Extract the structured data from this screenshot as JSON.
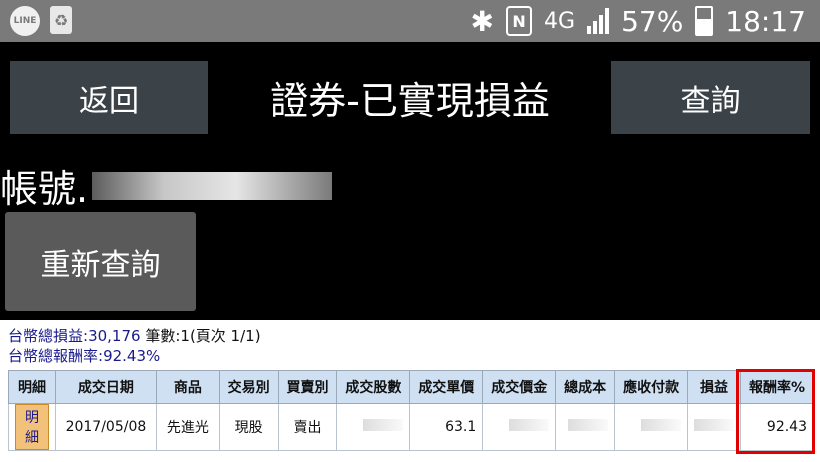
{
  "status_bar": {
    "line_label": "LINE",
    "network": "4G",
    "battery": "57%",
    "time": "18:17"
  },
  "header": {
    "back_label": "返回",
    "title": "證券-已實現損益",
    "query_label": "查詢"
  },
  "account": {
    "label": "帳號."
  },
  "requery_label": "重新查詢",
  "summary": {
    "total_pnl_label": "台幣總損益:",
    "total_pnl": "30,176",
    "count_text": "筆數:1(頁次 1/1)",
    "total_return_label": "台幣總報酬率:",
    "total_return": "92.43%"
  },
  "table": {
    "headers": [
      "明細",
      "成交日期",
      "商品",
      "交易別",
      "買賣別",
      "成交股數",
      "成交單價",
      "成交價金",
      "總成本",
      "應收付款",
      "損益",
      "報酬率%"
    ],
    "rows": [
      {
        "detail": "明細",
        "date": "2017/05/08",
        "product": "先進光",
        "trade_type": "現股",
        "side": "賣出",
        "shares": "",
        "price": "63.1",
        "amount": "",
        "total_cost": "",
        "receivable": "",
        "pnl": "",
        "return_pct": "92.43"
      }
    ]
  },
  "colors": {
    "highlight": "#e00000",
    "header_bg": "#cfe0f3",
    "link": "#1a1a8c"
  }
}
